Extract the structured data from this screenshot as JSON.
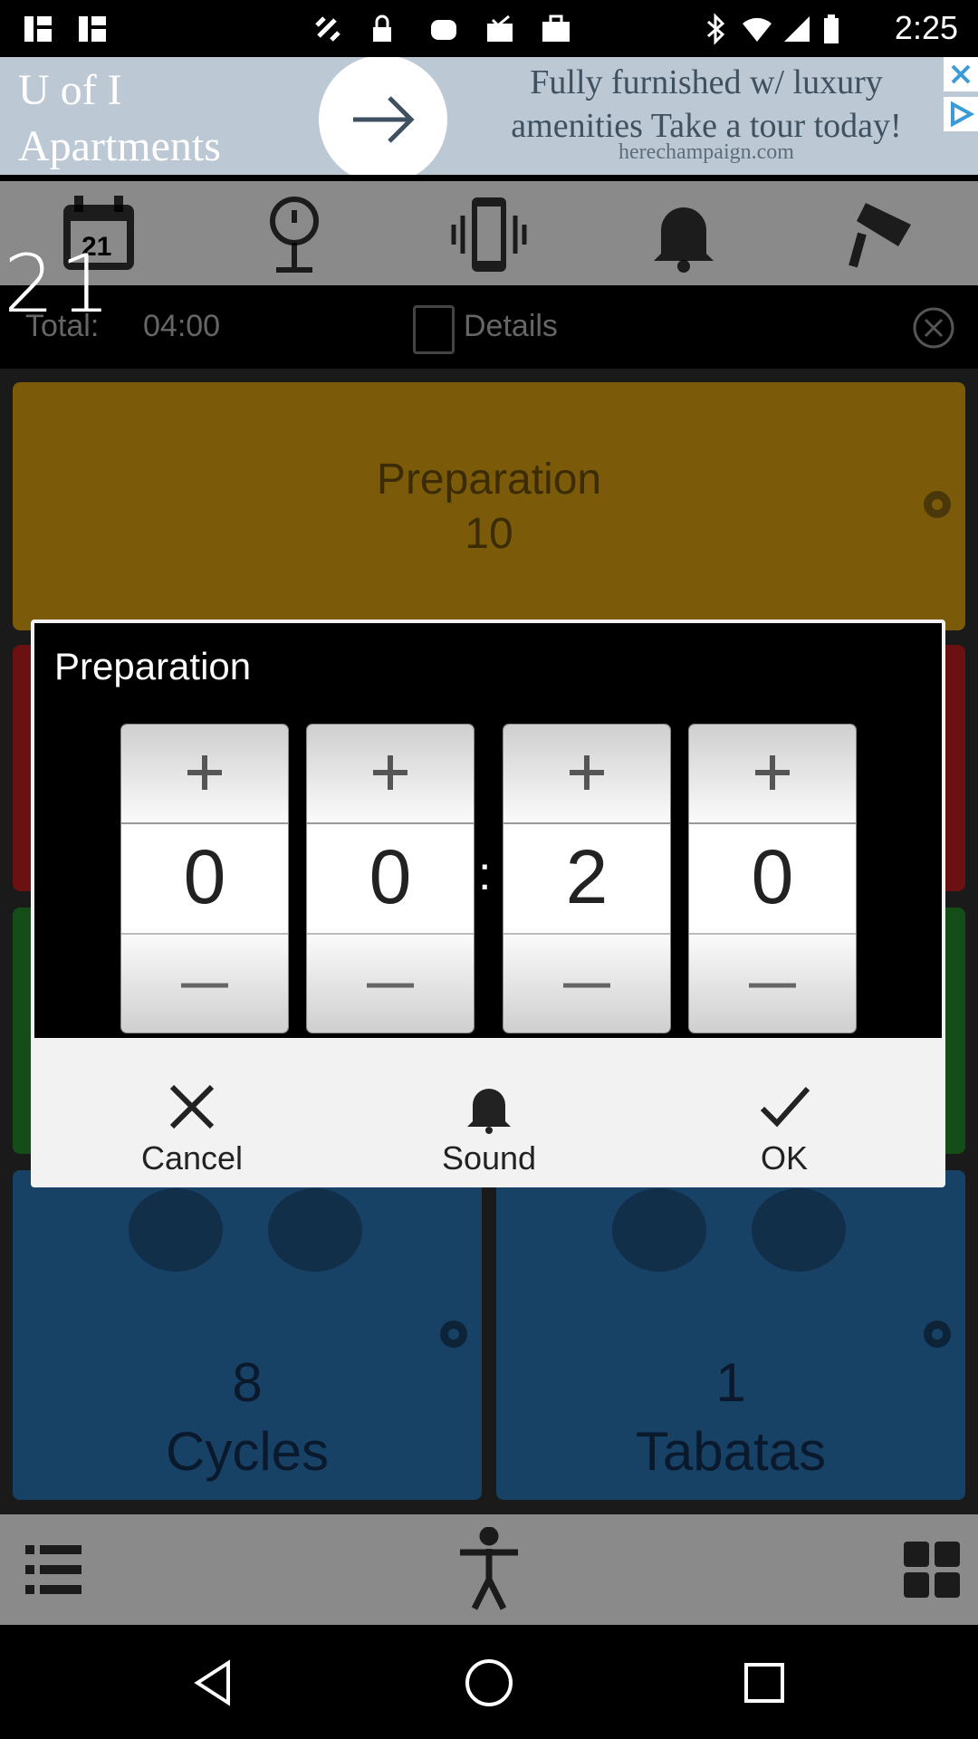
{
  "status_bar": {
    "time": "2:25"
  },
  "ad": {
    "left_text": "U of I Apartments",
    "left_line1": "U of I",
    "left_line2": "Apartments",
    "headline_line1": "Fully furnished w/ luxury",
    "headline_line2": "amenities Take a tour today!",
    "url": "herechampaign.com"
  },
  "toolbar": {
    "icons": [
      "calendar-icon",
      "timer-stand-icon",
      "vibrate-phone-icon",
      "bell-icon",
      "paint-roller-icon"
    ],
    "calendar_day": "21"
  },
  "overlay_number": "21",
  "summary": {
    "total_label": "Total:",
    "total_value": "04:00",
    "details_label": "Details"
  },
  "cards": {
    "preparation": {
      "title": "Preparation",
      "value": "10"
    },
    "cycles": {
      "value": "8",
      "label": "Cycles"
    },
    "tabatas": {
      "value": "1",
      "label": "Tabatas"
    }
  },
  "dialog": {
    "title": "Preparation",
    "digits": [
      "0",
      "0",
      "2",
      "0"
    ],
    "separator": ":",
    "buttons": {
      "cancel": "Cancel",
      "sound": "Sound",
      "ok": "OK"
    }
  },
  "colors": {
    "preparation": "#7b5b0a",
    "work": "#6c1111",
    "rest": "#154d18",
    "cycles": "#184166",
    "toolbar": "#8a8a8a"
  }
}
